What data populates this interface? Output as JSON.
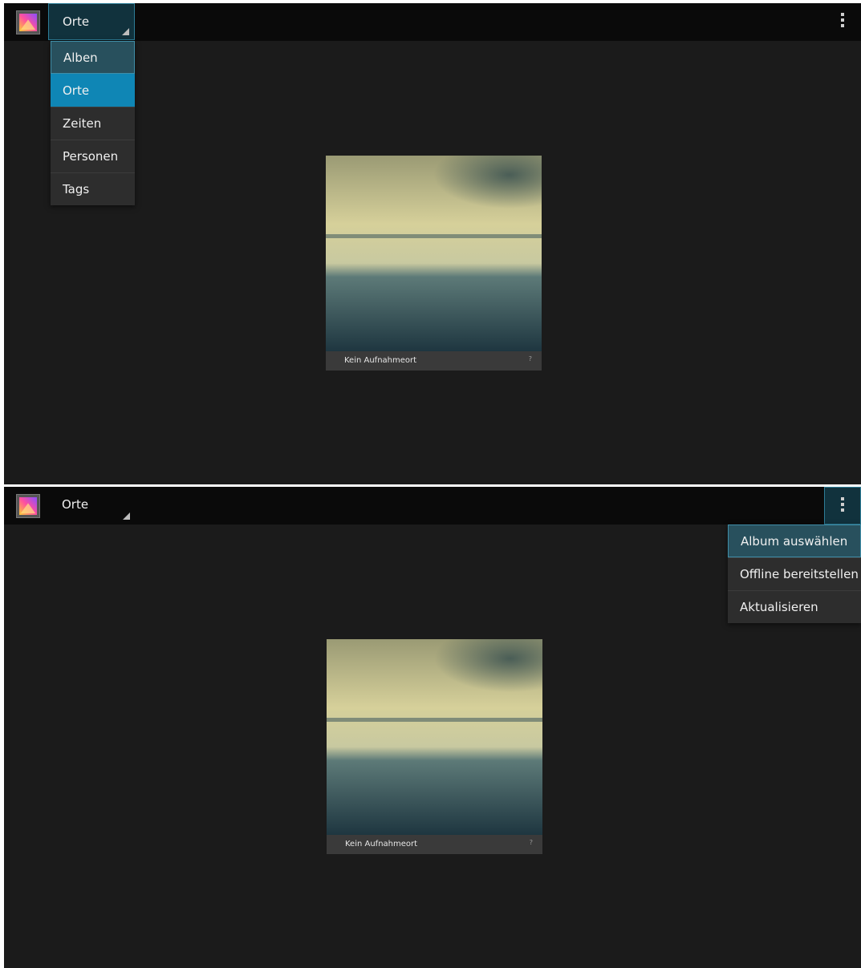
{
  "top_screen": {
    "nav_spinner": {
      "label": "Orte",
      "open": true
    },
    "nav_options": [
      "Alben",
      "Orte",
      "Zeiten",
      "Personen",
      "Tags"
    ],
    "focused_option": "Alben",
    "selected_option": "Orte",
    "tile": {
      "caption": "Kein Aufnahmeort",
      "count": "?"
    }
  },
  "bottom_screen": {
    "nav_spinner": {
      "label": "Orte",
      "open": false
    },
    "overflow_menu": [
      "Album auswählen",
      "Offline bereitstellen",
      "Aktualisieren"
    ],
    "focused_menu_item": "Album auswählen",
    "tile": {
      "caption": "Kein Aufnahmeort",
      "count": "?"
    }
  },
  "icons": {
    "app": "gallery-icon",
    "overflow": "overflow-menu-icon",
    "caret": "spinner-caret-icon"
  },
  "colors": {
    "background": "#1b1b1b",
    "action_bar": "#0a0a0a",
    "accent_selected": "#0f86b5",
    "focus_border": "#3f8ea8",
    "menu_background": "#2d2d2d"
  }
}
